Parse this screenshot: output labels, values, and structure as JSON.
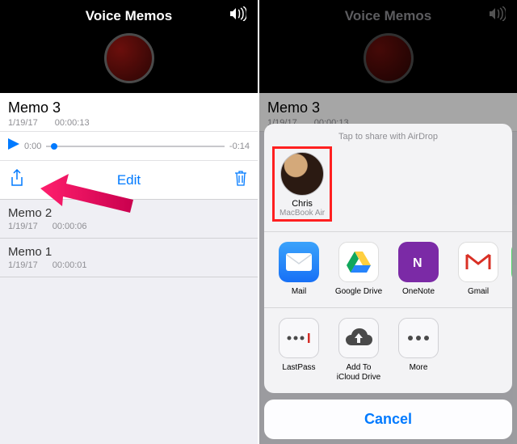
{
  "app_title": "Voice Memos",
  "left": {
    "selected": {
      "title": "Memo 3",
      "date": "1/19/17",
      "duration": "00:00:13",
      "elapsed": "0:00",
      "remaining": "-0:14"
    },
    "edit_label": "Edit",
    "memos": [
      {
        "title": "Memo 2",
        "date": "1/19/17",
        "duration": "00:00:06"
      },
      {
        "title": "Memo 1",
        "date": "1/19/17",
        "duration": "00:00:01"
      }
    ]
  },
  "right": {
    "selected": {
      "title": "Memo 3",
      "date": "1/19/17",
      "duration": "00:00:13"
    },
    "airdrop_hint": "Tap to share with AirDrop",
    "contact": {
      "name": "Chris",
      "device": "MacBook Air"
    },
    "apps": [
      {
        "label": "Mail"
      },
      {
        "label": "Google Drive"
      },
      {
        "label": "OneNote"
      },
      {
        "label": "Gmail"
      }
    ],
    "actions": [
      {
        "label": "LastPass"
      },
      {
        "label": "Add To\niCloud Drive"
      },
      {
        "label": "More"
      }
    ],
    "cancel_label": "Cancel"
  }
}
